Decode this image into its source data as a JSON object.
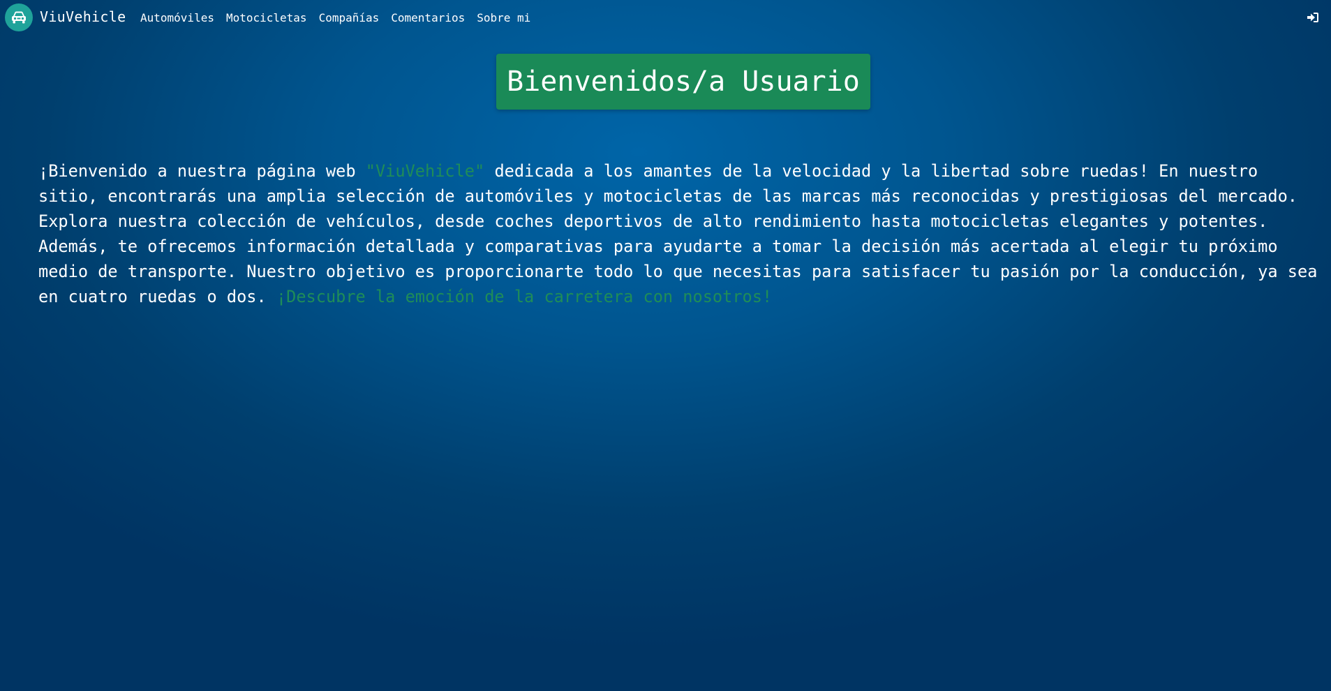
{
  "navbar": {
    "brand": "ViuVehicle",
    "logo_icon": "car-front-icon",
    "links": [
      {
        "label": "Automóviles"
      },
      {
        "label": "Motocicletas"
      },
      {
        "label": "Compañías"
      },
      {
        "label": "Comentarios"
      },
      {
        "label": "Sobre mi"
      }
    ],
    "login_icon": "sign-in-icon"
  },
  "main": {
    "welcome_title": "Bienvenidos/a Usuario",
    "intro": {
      "part1": "¡Bienvenido a nuestra página web ",
      "brand_quote": "\"ViuVehicle\"",
      "part2": " dedicada a los amantes de la velocidad y la libertad sobre ruedas! En nuestro sitio, encontrarás una amplia selección de automóviles y motocicletas de las marcas más reconocidas y prestigiosas del mercado. Explora nuestra colección de vehículos, desde coches deportivos de alto rendimiento hasta motocicletas elegantes y potentes. Además, te ofrecemos información detallada y comparativas para ayudarte a tomar la decisión más acertada al elegir tu próximo medio de transporte. Nuestro objetivo es proporcionarte todo lo que necesitas para satisfacer tu pasión por la conducción, ya sea en cuatro ruedas o dos. ",
      "tagline": "¡Descubre la emoción de la carretera con nosotros!"
    }
  },
  "colors": {
    "accent_green": "#1a8a57",
    "logo_teal": "#1fa39a",
    "background_blue": "#00558f"
  }
}
